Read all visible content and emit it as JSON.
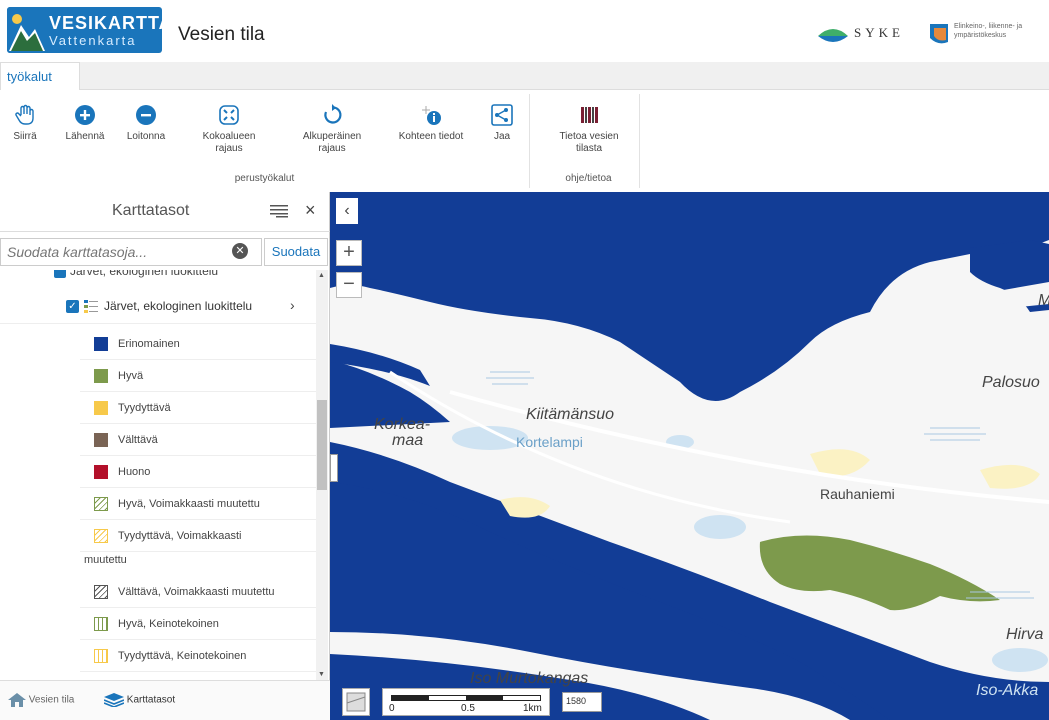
{
  "header": {
    "logo_title": "VESIKARTTA",
    "logo_sub": "Vattenkarta",
    "app_title": "Vesien tila",
    "syke_text": "SYKE",
    "ely_text": "Elinkeino-, liikenne- ja ympäristökeskus"
  },
  "tabs": {
    "tools": "työkalut"
  },
  "ribbon": {
    "basic_group": "perustyökalut",
    "info_group": "ohje/tietoa",
    "tools": [
      {
        "label": "Siirrä",
        "icon": "hand-icon"
      },
      {
        "label": "Lähennä",
        "icon": "zoom-in-icon"
      },
      {
        "label": "Loitonna",
        "icon": "zoom-out-icon"
      },
      {
        "label": "Kokoalueen rajaus",
        "icon": "full-extent-icon"
      },
      {
        "label": "Alkuperäinen rajaus",
        "icon": "original-extent-icon"
      },
      {
        "label": "Kohteen tiedot",
        "icon": "info-icon"
      },
      {
        "label": "Jaa",
        "icon": "share-icon"
      }
    ],
    "info_tool": {
      "label": "Tietoa vesien tilasta",
      "icon": "book-icon"
    }
  },
  "panel": {
    "title": "Karttatasot",
    "filter_placeholder": "Suodata karttatasoja...",
    "filter_button": "Suodata",
    "cut_item": "Järvet, ekologinen luokittelu",
    "layer_name": "Järvet, ekologinen luokittelu",
    "legend": [
      {
        "label": "Erinomainen",
        "color": "#123d96",
        "pattern": "solid"
      },
      {
        "label": "Hyvä",
        "color": "#7d9a4c",
        "pattern": "solid"
      },
      {
        "label": "Tyydyttävä",
        "color": "#f7c94a",
        "pattern": "solid"
      },
      {
        "label": "Välttävä",
        "color": "#7a6455",
        "pattern": "solid"
      },
      {
        "label": "Huono",
        "color": "#b3102a",
        "pattern": "solid"
      },
      {
        "label": "Hyvä, Voimakkaasti muutettu",
        "color": "#7d9a4c",
        "pattern": "hatch"
      },
      {
        "label": "Tyydyttävä, Voimakkaasti",
        "color": "#f7c94a",
        "pattern": "hatch"
      },
      {
        "label": "Välttävä, Voimakkaasti muutettu",
        "color": "#555555",
        "pattern": "hatch"
      },
      {
        "label": "Hyvä, Keinotekoinen",
        "color": "#7d9a4c",
        "pattern": "vlines"
      },
      {
        "label": "Tyydyttävä, Keinotekoinen",
        "color": "#f7c94a",
        "pattern": "vlines"
      }
    ],
    "wrap_continuation": "muutettu",
    "bottom_tabs": {
      "vesien_tila": "Vesien tila",
      "karttatasot": "Karttatasot"
    }
  },
  "map": {
    "places": {
      "korkea": "Korkea-",
      "maa": "maa",
      "kiitamansuo": "Kiitämänsuo",
      "kortelampi": "Kortelampi",
      "palosuo": "Palosuo",
      "rauhaniemi": "Rauhaniemi",
      "hirva": "Hirva",
      "iso_murtokangas": "Iso Murtokangas",
      "iso_akka": "Iso-Akka",
      "m": "M"
    },
    "scale": {
      "l0": "0",
      "l1": "0.5",
      "l2": "1km"
    },
    "zoom_value": "1580"
  }
}
